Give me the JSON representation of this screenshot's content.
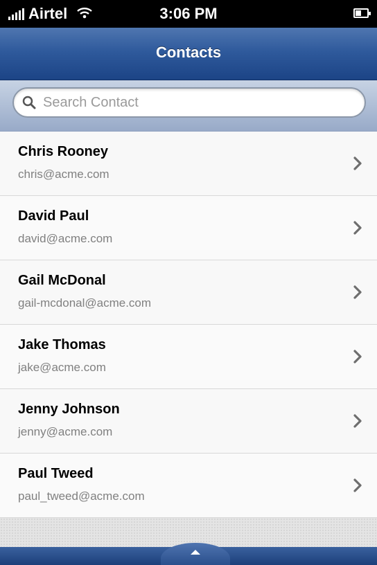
{
  "status_bar": {
    "carrier": "Airtel",
    "time": "3:06 PM"
  },
  "nav_bar": {
    "title": "Contacts"
  },
  "search": {
    "placeholder": "Search Contact",
    "value": ""
  },
  "contacts": [
    {
      "name": "Chris Rooney",
      "email": "chris@acme.com"
    },
    {
      "name": "David Paul",
      "email": "david@acme.com"
    },
    {
      "name": "Gail McDonal",
      "email": "gail-mcdonal@acme.com"
    },
    {
      "name": "Jake Thomas",
      "email": "jake@acme.com"
    },
    {
      "name": "Jenny Johnson",
      "email": "jenny@acme.com"
    },
    {
      "name": "Paul Tweed",
      "email": "paul_tweed@acme.com"
    }
  ],
  "icons": {
    "search": "search-icon",
    "chevron": "chevron-right-icon",
    "tray": "chevron-up-icon",
    "signal": "signal-icon",
    "wifi": "wifi-icon",
    "battery": "battery-icon"
  },
  "colors": {
    "nav_bar": "#2f5a9c",
    "search_area": "#a9b8d2",
    "list_bg": "#fafafa",
    "email_text": "#808080"
  }
}
